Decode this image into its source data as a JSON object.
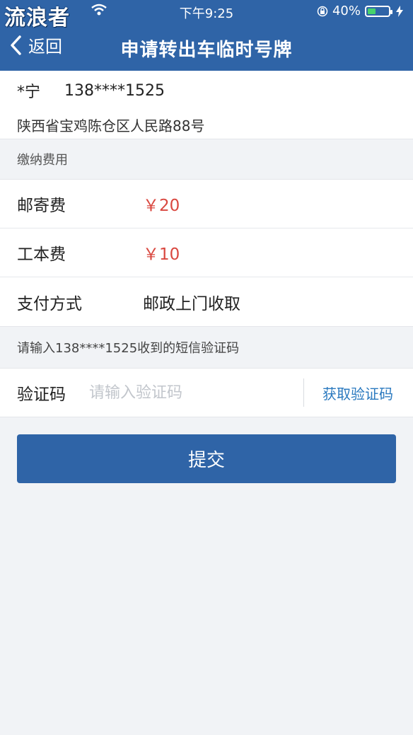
{
  "status_bar": {
    "watermark": "流浪者",
    "time": "下午9:25",
    "battery_percent_text": "40%",
    "battery_level": 0.4,
    "icons": [
      "wifi-icon",
      "lock-rotation-icon",
      "battery-icon",
      "charging-bolt-icon"
    ]
  },
  "nav": {
    "back_label": "返回",
    "title": "申请转出车临时号牌"
  },
  "recipient": {
    "name": "*宁",
    "phone": "138****1525",
    "address": "陕西省宝鸡陈仓区人民路88号"
  },
  "fees": {
    "section_label": "缴纳费用",
    "postage_label": "邮寄费",
    "postage_value": "￥20",
    "production_label": "工本费",
    "production_value": "￥10",
    "payment_label": "支付方式",
    "payment_value": "邮政上门收取"
  },
  "verification": {
    "prompt": "请输入138****1525收到的短信验证码",
    "label": "验证码",
    "placeholder": "请输入验证码",
    "value": "",
    "get_code_label": "获取验证码"
  },
  "submit_label": "提交",
  "colors": {
    "primary": "#2f64a7",
    "price_red": "#d9473f",
    "link_blue": "#2a79bf",
    "battery_green": "#46d36b"
  }
}
